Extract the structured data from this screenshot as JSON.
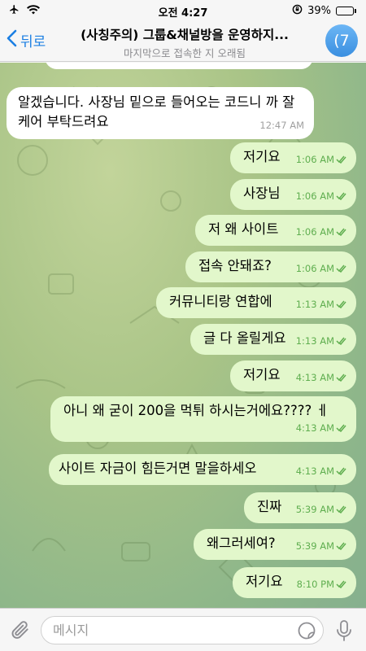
{
  "status_bar": {
    "time": "오전 4:27",
    "battery": "39%",
    "battery_level": 0.39
  },
  "header": {
    "back_label": "뒤로",
    "title": "(사칭주의) 그룹&채널방을 운영하지...",
    "subtitle": "마지막으로 접속한 지 오래됨",
    "avatar_text": "(7"
  },
  "messages": [
    {
      "dir": "in",
      "text": "알겠습니다. 사장님 밑으로 들어오는 코드니 까 잘 케어 부탁드려요",
      "time": "12:47 AM"
    },
    {
      "dir": "out",
      "text": "저기요",
      "time": "1:06 AM"
    },
    {
      "dir": "out",
      "text": "사장님",
      "time": "1:06 AM"
    },
    {
      "dir": "out",
      "text": "저 왜 사이트",
      "time": "1:06 AM"
    },
    {
      "dir": "out",
      "text": "접속 안돼죠?",
      "time": "1:06 AM"
    },
    {
      "dir": "out",
      "text": "커뮤니티랑 연합에",
      "time": "1:13 AM"
    },
    {
      "dir": "out",
      "text": "글 다 올릴게요",
      "time": "1:13 AM"
    },
    {
      "dir": "out",
      "text": "저기요",
      "time": "4:13 AM"
    },
    {
      "dir": "out",
      "text": "아니 왜 굳이 200을 먹튀 하시는거에요???? ㅔ",
      "time": "4:13 AM"
    },
    {
      "dir": "out",
      "text": "사이트 자금이 힘든거면 말을하세오",
      "time": "4:13 AM"
    },
    {
      "dir": "out",
      "text": "진짜",
      "time": "5:39 AM"
    },
    {
      "dir": "out",
      "text": "왜그러세여?",
      "time": "5:39 AM"
    },
    {
      "dir": "out",
      "text": "저기요",
      "time": "8:10 PM"
    }
  ],
  "input": {
    "placeholder": "메시지"
  },
  "colors": {
    "accent": "#1b7fe3",
    "outgoing_bubble": "#e2f7cb",
    "incoming_bubble": "#ffffff",
    "check": "#5fae4f"
  },
  "icons": [
    "airplane-icon",
    "wifi-icon",
    "lock-rotation-icon",
    "battery-icon",
    "chevron-left-icon",
    "paperclip-icon",
    "sticker-icon",
    "microphone-icon",
    "double-check-icon"
  ]
}
